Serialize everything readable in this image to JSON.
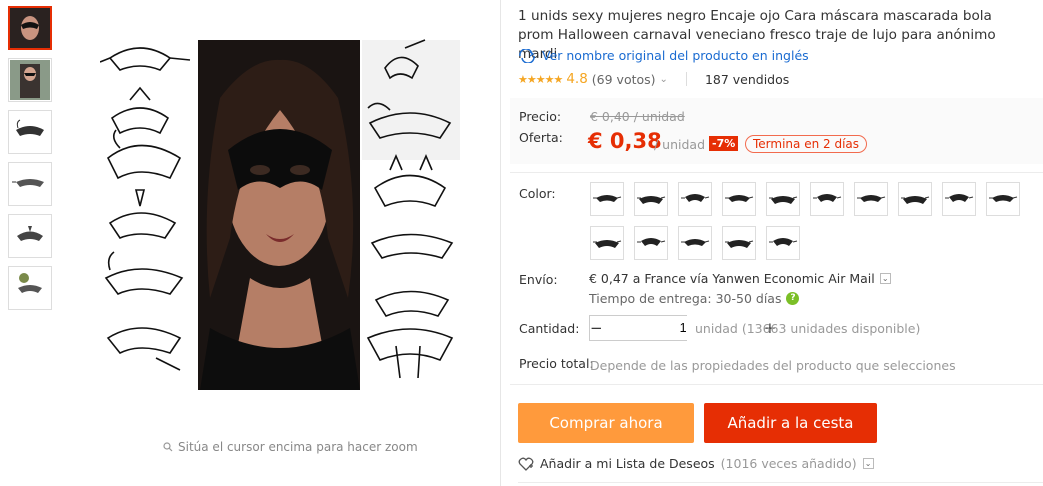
{
  "product": {
    "title": "1 unids sexy mujeres negro Encaje ojo Cara máscara mascarada bola prom Halloween carnaval veneciano fresco traje de lujo para anónimo mardi",
    "original_name_link": "Ver nombre original del producto en inglés",
    "rating": "4.8",
    "votes": "(69 votos)",
    "sold": "187 vendidos",
    "stars": "★★★★★"
  },
  "image": {
    "zoom_hint": "Sitúa el cursor encima para hacer zoom"
  },
  "price": {
    "price_label": "Precio:",
    "old_price": "€ 0,40 / unidad",
    "offer_label": "Oferta:",
    "new_price": "€ 0,38",
    "unit": "/ unidad",
    "discount": "-7%",
    "ends": "Termina en 2 días"
  },
  "color": {
    "label": "Color:",
    "swatch_count": 15
  },
  "shipping": {
    "label": "Envío:",
    "text": "€ 0,47 a France vía Yanwen Economic Air Mail",
    "delivery": "Tiempo de entrega: 30-50 días"
  },
  "quantity": {
    "label": "Cantidad:",
    "value": "1",
    "minus": "−",
    "plus": "+",
    "available": "unidad (13663 unidades disponible)"
  },
  "total": {
    "label": "Precio total:",
    "value": "Depende de las propiedades del producto que selecciones"
  },
  "actions": {
    "buy": "Comprar ahora",
    "cart": "Añadir a la cesta",
    "wishlist": "Añadir a mi Lista de Deseos",
    "wishlist_count": "(1016 veces añadido)"
  },
  "colors": {
    "accent": "#e62e04",
    "buy": "#ff9a3c",
    "link": "#1a6bd1",
    "star": "#f5a623"
  }
}
